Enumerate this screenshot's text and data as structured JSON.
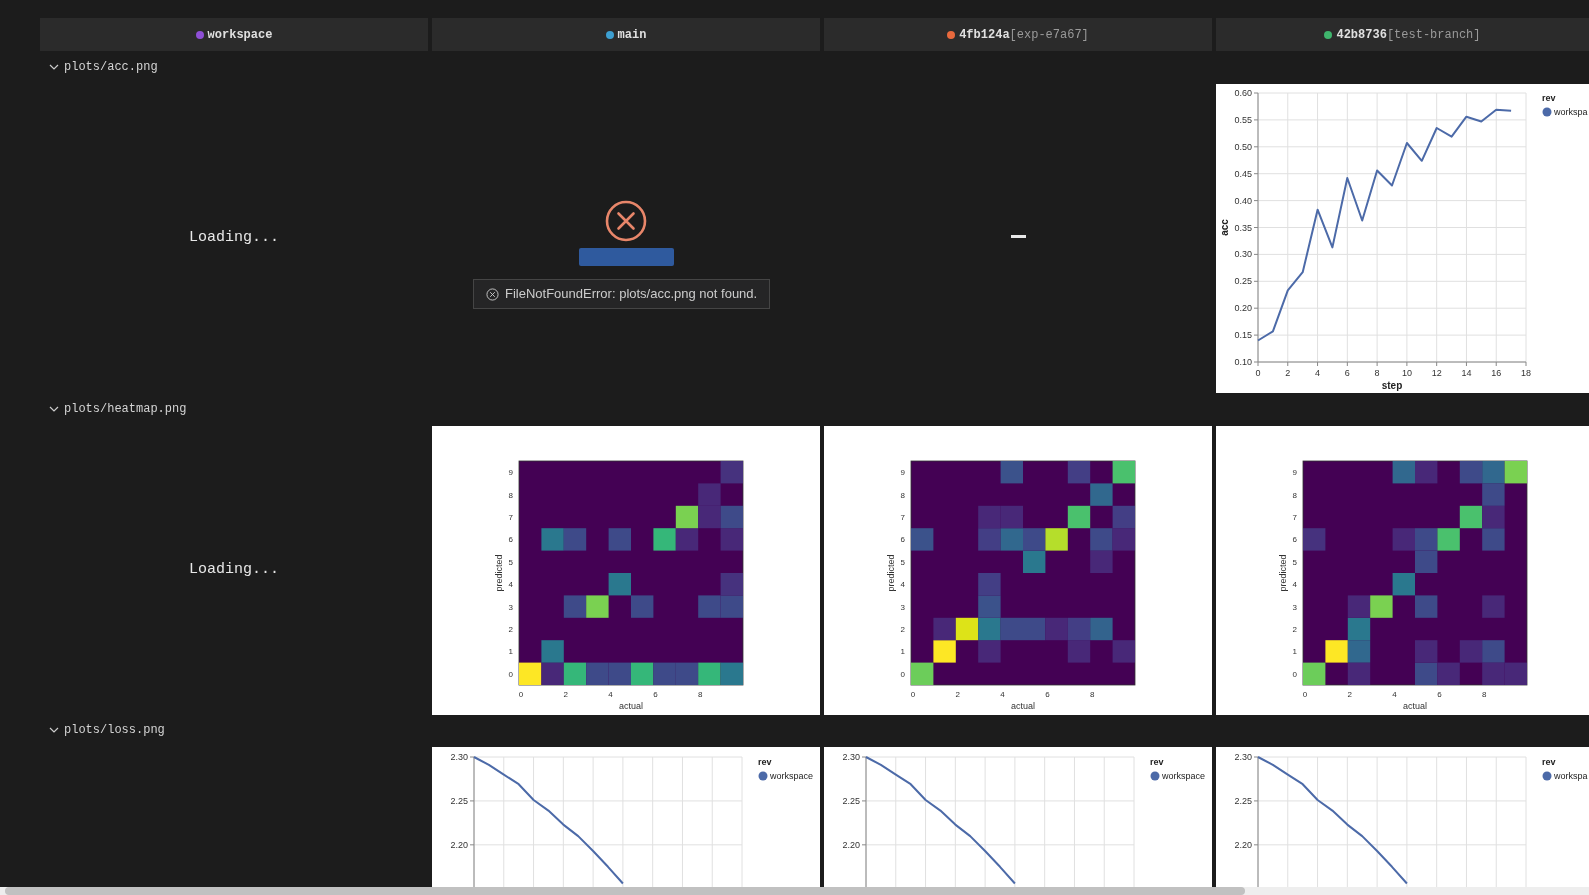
{
  "columns": [
    {
      "rev": "workspace",
      "color": "#8e4fd6"
    },
    {
      "rev": "main",
      "color": "#3d9fd1"
    },
    {
      "rev": "4fb124a",
      "branch": "[exp-e7a67]",
      "color": "#e8693d"
    },
    {
      "rev": "42b8736",
      "branch": "[test-branch]",
      "color": "#3fb56d"
    }
  ],
  "sections": [
    {
      "path": "plots/acc.png",
      "expanded": true,
      "cells": [
        {
          "kind": "loading",
          "text": "Loading..."
        },
        {
          "kind": "error",
          "tooltip": "FileNotFoundError: plots/acc.png not found."
        },
        {
          "kind": "empty"
        },
        {
          "kind": "line_chart",
          "legend_title": "rev",
          "chart_data": {
            "type": "line",
            "xlabel": "step",
            "ylabel": "acc",
            "x": [
              0,
              1,
              2,
              3,
              4,
              5,
              6,
              7,
              8,
              9,
              10,
              11,
              12,
              13,
              14,
              15,
              16,
              17
            ],
            "series": [
              {
                "name": "workspa",
                "color": "#4c6aa8",
                "values": [
                  0.14,
                  0.157,
                  0.233,
                  0.267,
                  0.383,
                  0.313,
                  0.442,
                  0.363,
                  0.456,
                  0.428,
                  0.507,
                  0.474,
                  0.535,
                  0.519,
                  0.556,
                  0.547,
                  0.569,
                  0.567
                ]
              }
            ],
            "xlim": [
              0,
              18
            ],
            "ylim": [
              0.1,
              0.6
            ],
            "grid": true,
            "xticks": [
              0,
              2,
              4,
              6,
              8,
              10,
              12,
              14,
              16,
              18
            ],
            "yticks": [
              {
                "value": 0.1,
                "label": "0.10"
              },
              {
                "value": 0.15,
                "label": "0.15"
              },
              {
                "value": 0.2,
                "label": "0.20"
              },
              {
                "value": 0.25,
                "label": "0.25"
              },
              {
                "value": 0.3,
                "label": "0.30"
              },
              {
                "value": 0.35,
                "label": "0.35"
              },
              {
                "value": 0.4,
                "label": "0.40"
              },
              {
                "value": 0.45,
                "label": "0.45"
              },
              {
                "value": 0.5,
                "label": "0.50"
              },
              {
                "value": 0.55,
                "label": "0.55"
              },
              {
                "value": 0.6,
                "label": "0.60"
              }
            ]
          }
        }
      ]
    },
    {
      "path": "plots/heatmap.png",
      "expanded": true,
      "cells": [
        {
          "kind": "loading",
          "text": "Loading..."
        },
        {
          "kind": "heatmap",
          "xlabel": "actual",
          "ylabel": "predicted",
          "xticks": [
            "0",
            "2",
            "4",
            "6",
            "8"
          ],
          "yticks": [
            "9",
            "8",
            "7",
            "6",
            "5",
            "4",
            "3",
            "2",
            "1",
            "0"
          ]
        },
        {
          "kind": "heatmap",
          "xlabel": "actual",
          "ylabel": "predicted",
          "xticks": [
            "0",
            "2",
            "4",
            "6",
            "8"
          ],
          "yticks": [
            "9",
            "8",
            "7",
            "6",
            "5",
            "4",
            "3",
            "2",
            "1",
            "0"
          ]
        },
        {
          "kind": "heatmap",
          "xlabel": "actual",
          "ylabel": "predicted",
          "xticks": [
            "0",
            "2",
            "4",
            "6",
            "8"
          ],
          "yticks": [
            "9",
            "8",
            "7",
            "6",
            "5",
            "4",
            "3",
            "2",
            "1",
            "0"
          ]
        }
      ]
    },
    {
      "path": "plots/loss.png",
      "expanded": true,
      "cells": [
        {
          "kind": "blank"
        },
        {
          "kind": "line_chart",
          "legend_title": "rev",
          "chart_data": {
            "type": "line",
            "series": [
              {
                "name": "workspace",
                "color": "#4c6aa8",
                "values": [
                  2.3,
                  2.291,
                  2.28,
                  2.269,
                  2.251,
                  2.239,
                  2.223,
                  2.21,
                  2.193,
                  2.175,
                  2.156
                ]
              }
            ],
            "ylim": [
              2.152,
              2.3
            ],
            "grid": true,
            "yticks": [
              {
                "value": 2.3,
                "label": "2.30"
              },
              {
                "value": 2.25,
                "label": "2.25"
              },
              {
                "value": 2.2,
                "label": "2.20"
              }
            ]
          }
        },
        {
          "kind": "line_chart",
          "legend_title": "rev",
          "chart_data": {
            "type": "line",
            "series": [
              {
                "name": "workspace",
                "color": "#4c6aa8",
                "values": [
                  2.3,
                  2.291,
                  2.28,
                  2.269,
                  2.251,
                  2.239,
                  2.223,
                  2.21,
                  2.193,
                  2.175,
                  2.156
                ]
              }
            ],
            "ylim": [
              2.152,
              2.3
            ],
            "grid": true,
            "yticks": [
              {
                "value": 2.3,
                "label": "2.30"
              },
              {
                "value": 2.25,
                "label": "2.25"
              },
              {
                "value": 2.2,
                "label": "2.20"
              }
            ]
          }
        },
        {
          "kind": "line_chart",
          "legend_title": "rev",
          "chart_data": {
            "type": "line",
            "series": [
              {
                "name": "workspa",
                "color": "#4c6aa8",
                "values": [
                  2.3,
                  2.291,
                  2.28,
                  2.269,
                  2.251,
                  2.239,
                  2.223,
                  2.21,
                  2.193,
                  2.175,
                  2.156
                ]
              }
            ],
            "ylim": [
              2.152,
              2.3
            ],
            "grid": true,
            "yticks": [
              {
                "value": 2.3,
                "label": "2.30"
              },
              {
                "value": 2.25,
                "label": "2.25"
              },
              {
                "value": 2.2,
                "label": "2.20"
              }
            ]
          }
        }
      ]
    }
  ]
}
